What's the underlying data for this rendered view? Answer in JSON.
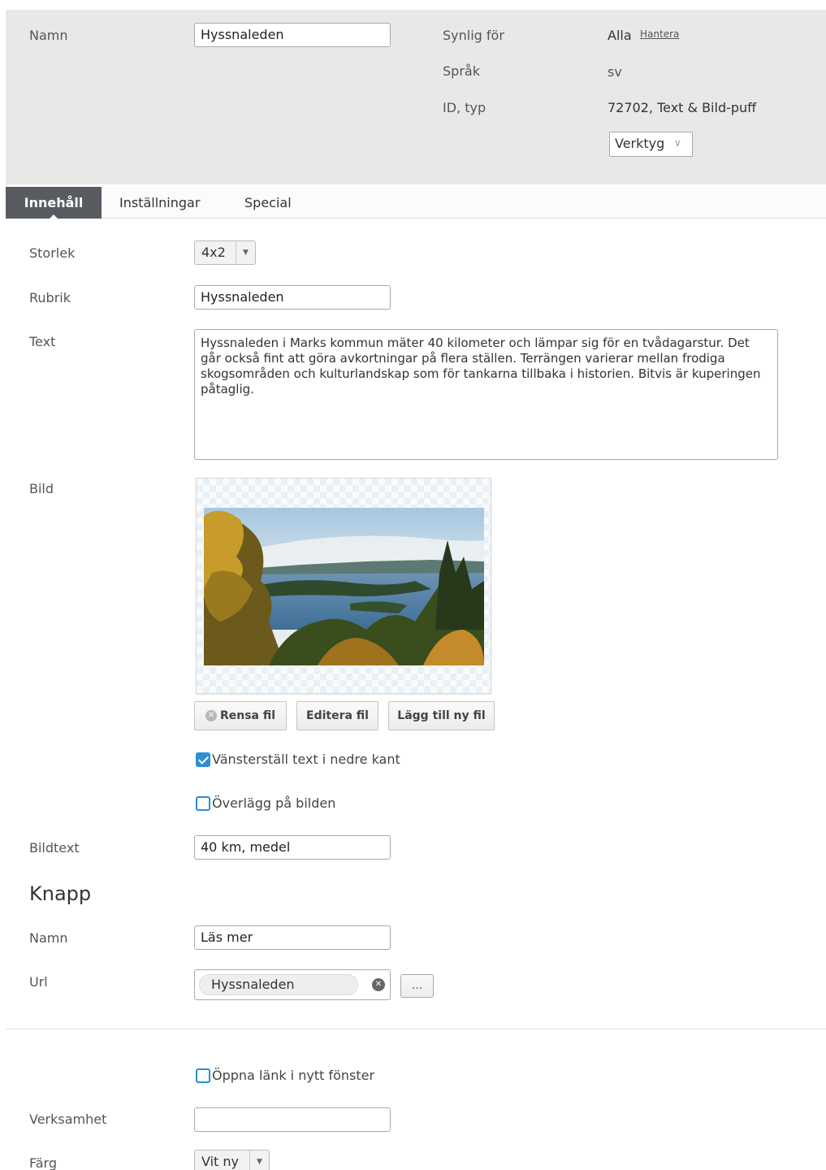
{
  "header": {
    "name_label": "Namn",
    "name_value": "Hyssnaleden",
    "visible_label": "Synlig för",
    "visible_value": "Alla",
    "manage_link": "Hantera",
    "language_label": "Språk",
    "language_value": "sv",
    "idtype_label": "ID, typ",
    "idtype_value": "72702, Text & Bild-puff",
    "tools_label": "Verktyg"
  },
  "tabs": [
    {
      "label": "Innehåll",
      "active": true
    },
    {
      "label": "Inställningar",
      "active": false
    },
    {
      "label": "Special",
      "active": false
    }
  ],
  "content": {
    "size_label": "Storlek",
    "size_value": "4x2",
    "heading_label": "Rubrik",
    "heading_value": "Hyssnaleden",
    "text_label": "Text",
    "text_value": "Hyssnaleden i Marks kommun mäter 40 kilometer och lämpar sig för en tvådagarstur. Det går också fint att göra avkortningar på flera ställen. Terrängen varierar mellan frodiga skogsområden och kulturlandskap som för tankarna tillbaka i historien. Bitvis är kuperingen påtaglig.",
    "image_label": "Bild",
    "clear_file": "Rensa fil",
    "edit_file": "Editera fil",
    "add_file": "Lägg till ny fil",
    "align_check_label": "Vänsterställ text i nedre kant",
    "align_check_checked": true,
    "overlay_check_label": "Överlägg på bilden",
    "overlay_check_checked": false,
    "caption_label": "Bildtext",
    "caption_value": "40 km, medel"
  },
  "button_section": {
    "title": "Knapp",
    "name_label": "Namn",
    "name_value": "Läs mer",
    "url_label": "Url",
    "url_value": "Hyssnaleden",
    "browse_label": "..."
  },
  "extra": {
    "new_window_label": "Öppna länk i nytt fönster",
    "new_window_checked": false,
    "business_label": "Verksamhet",
    "business_value": "",
    "color_label": "Färg",
    "color_value": "Vit ny"
  },
  "colors": {
    "header_bg": "#e8e8e6",
    "active_tab_bg": "#585b60",
    "accent": "#2a8fd4"
  }
}
